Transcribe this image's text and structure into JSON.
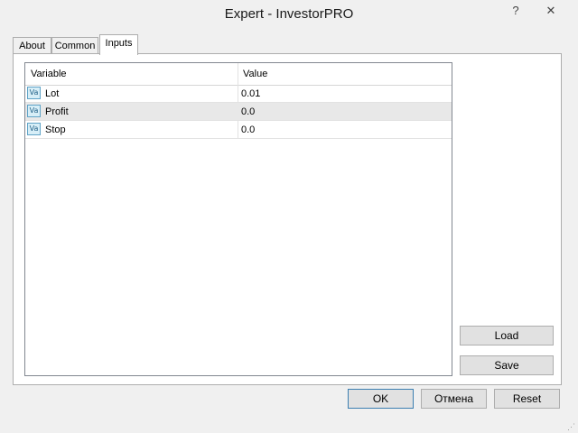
{
  "window": {
    "title": "Expert - InvestorPRO",
    "help_glyph": "?",
    "close_glyph": "✕"
  },
  "tabs": [
    {
      "label": "About"
    },
    {
      "label": "Common"
    },
    {
      "label": "Inputs",
      "active": true
    }
  ],
  "inputs_table": {
    "columns": [
      "Variable",
      "Value"
    ],
    "rows": [
      {
        "icon": "variable-icon",
        "icon_text": "Va",
        "variable": "Lot",
        "value": "0.01"
      },
      {
        "icon": "variable-icon",
        "icon_text": "Va",
        "variable": "Profit",
        "value": "0.0",
        "selected": true
      },
      {
        "icon": "variable-icon",
        "icon_text": "Va",
        "variable": "Stop",
        "value": "0.0"
      }
    ]
  },
  "side_buttons": {
    "load_label": "Load",
    "save_label": "Save"
  },
  "dialog_buttons": {
    "ok_label": "OK",
    "cancel_label": "Отмена",
    "reset_label": "Reset"
  },
  "colors": {
    "window_bg": "#f0f0f0",
    "selected_row": "#e8e8e8",
    "icon_accent": "#5fa3c7"
  }
}
